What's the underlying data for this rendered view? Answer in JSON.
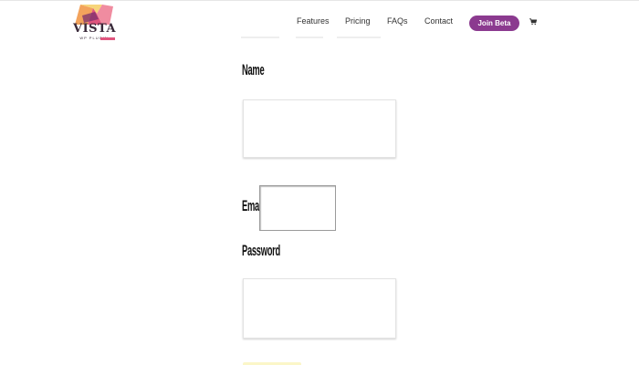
{
  "brand": {
    "name": "VISTA",
    "tagline": "WP PLUGIN",
    "colors": {
      "logo_pink": "#e0557e",
      "logo_orange": "#f3a35c",
      "logo_yellow": "#f7d57a",
      "logo_purple": "#7a2f6e"
    }
  },
  "nav": {
    "items": [
      {
        "label": "Features"
      },
      {
        "label": "Pricing"
      },
      {
        "label": "FAQs"
      },
      {
        "label": "Contact"
      }
    ],
    "cta_label": "Join Beta",
    "cta_color": "#8b3a8f",
    "cart_icon": "shopping-cart-icon"
  },
  "form": {
    "name_label": "Name",
    "name_value": "",
    "email_label": "Email",
    "email_value": "",
    "password_label": "Password",
    "password_value": "",
    "submit_color": "#fbf6c8"
  }
}
